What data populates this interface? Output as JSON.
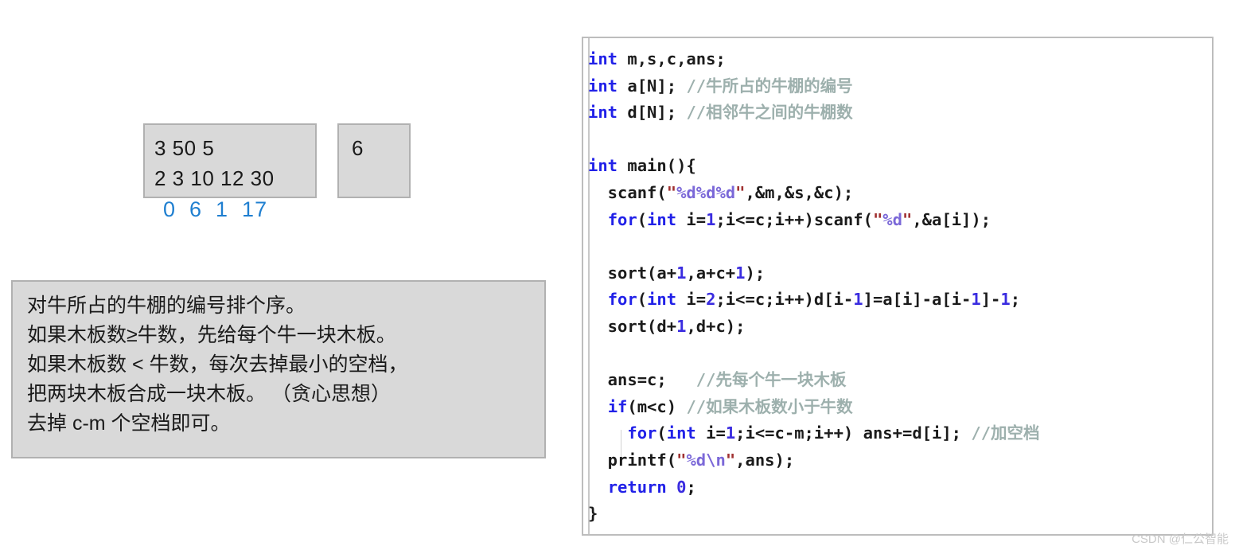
{
  "sample": {
    "input_box": {
      "lines": [
        "3 50 5",
        "2 3 10 12 30"
      ]
    },
    "output_box": {
      "lines": [
        "6"
      ]
    },
    "gap_numbers": "0  6  1  17"
  },
  "explanation": {
    "lines": [
      "对牛所占的牛棚的编号排个序。",
      "如果木板数≥牛数，先给每个牛一块木板。",
      "如果木板数 < 牛数，每次去掉最小的空档，",
      "把两块木板合成一块木板。 （贪心思想）",
      "去掉 c-m 个空档即可。"
    ]
  },
  "code": {
    "language": "cpp",
    "lines": [
      {
        "id": "l1",
        "tokens": [
          {
            "t": "int",
            "c": "kw"
          },
          {
            "t": " m,s,c,ans;",
            "c": "id"
          }
        ]
      },
      {
        "id": "l2",
        "tokens": [
          {
            "t": "int",
            "c": "kw"
          },
          {
            "t": " a[N]; ",
            "c": "id"
          },
          {
            "t": "//牛所占的牛棚的编号",
            "c": "cmt"
          }
        ]
      },
      {
        "id": "l3",
        "tokens": [
          {
            "t": "int",
            "c": "kw"
          },
          {
            "t": " d[N]; ",
            "c": "id"
          },
          {
            "t": "//相邻牛之间的牛棚数",
            "c": "cmt"
          }
        ]
      },
      {
        "id": "l4",
        "tokens": []
      },
      {
        "id": "l5",
        "tokens": [
          {
            "t": "int",
            "c": "kw"
          },
          {
            "t": " main(){",
            "c": "id"
          }
        ]
      },
      {
        "id": "l6",
        "tokens": [
          {
            "t": "  scanf(",
            "c": "id"
          },
          {
            "t": "\"",
            "c": "quo"
          },
          {
            "t": "%d%d%d",
            "c": "str"
          },
          {
            "t": "\"",
            "c": "quo"
          },
          {
            "t": ",&m,&s,&c);",
            "c": "id"
          }
        ]
      },
      {
        "id": "l7",
        "tokens": [
          {
            "t": "  ",
            "c": "id"
          },
          {
            "t": "for",
            "c": "kw"
          },
          {
            "t": "(",
            "c": "id"
          },
          {
            "t": "int",
            "c": "kw"
          },
          {
            "t": " i=",
            "c": "id"
          },
          {
            "t": "1",
            "c": "num"
          },
          {
            "t": ";i<=c;i++)scanf(",
            "c": "id"
          },
          {
            "t": "\"",
            "c": "quo"
          },
          {
            "t": "%d",
            "c": "str"
          },
          {
            "t": "\"",
            "c": "quo"
          },
          {
            "t": ",&a[i]);",
            "c": "id"
          }
        ]
      },
      {
        "id": "l8",
        "tokens": []
      },
      {
        "id": "l9",
        "tokens": [
          {
            "t": "  sort(a+",
            "c": "id"
          },
          {
            "t": "1",
            "c": "num"
          },
          {
            "t": ",a+c+",
            "c": "id"
          },
          {
            "t": "1",
            "c": "num"
          },
          {
            "t": ");",
            "c": "id"
          }
        ]
      },
      {
        "id": "l10",
        "tokens": [
          {
            "t": "  ",
            "c": "id"
          },
          {
            "t": "for",
            "c": "kw"
          },
          {
            "t": "(",
            "c": "id"
          },
          {
            "t": "int",
            "c": "kw"
          },
          {
            "t": " i=",
            "c": "id"
          },
          {
            "t": "2",
            "c": "num"
          },
          {
            "t": ";i<=c;i++)d[i-",
            "c": "id"
          },
          {
            "t": "1",
            "c": "num"
          },
          {
            "t": "]=a[i]-a[i-",
            "c": "id"
          },
          {
            "t": "1",
            "c": "num"
          },
          {
            "t": "]-",
            "c": "id"
          },
          {
            "t": "1",
            "c": "num"
          },
          {
            "t": ";",
            "c": "id"
          }
        ]
      },
      {
        "id": "l11",
        "tokens": [
          {
            "t": "  sort(d+",
            "c": "id"
          },
          {
            "t": "1",
            "c": "num"
          },
          {
            "t": ",d+c);",
            "c": "id"
          }
        ]
      },
      {
        "id": "l12",
        "tokens": []
      },
      {
        "id": "l13",
        "tokens": [
          {
            "t": "  ans=c;   ",
            "c": "id"
          },
          {
            "t": "//先每个牛一块木板",
            "c": "cmt"
          }
        ]
      },
      {
        "id": "l14",
        "tokens": [
          {
            "t": "  ",
            "c": "id"
          },
          {
            "t": "if",
            "c": "kw"
          },
          {
            "t": "(m<c) ",
            "c": "id"
          },
          {
            "t": "//如果木板数小于牛数",
            "c": "cmt"
          }
        ]
      },
      {
        "id": "l15",
        "tokens": [
          {
            "t": "    ",
            "c": "id"
          },
          {
            "t": "for",
            "c": "kw"
          },
          {
            "t": "(",
            "c": "id"
          },
          {
            "t": "int",
            "c": "kw"
          },
          {
            "t": " i=",
            "c": "id"
          },
          {
            "t": "1",
            "c": "num"
          },
          {
            "t": ";i<=c-m;i++) ans+=d[i]; ",
            "c": "id"
          },
          {
            "t": "//加空档",
            "c": "cmt"
          }
        ]
      },
      {
        "id": "l16",
        "tokens": [
          {
            "t": "  printf(",
            "c": "id"
          },
          {
            "t": "\"",
            "c": "quo"
          },
          {
            "t": "%d\\n",
            "c": "str"
          },
          {
            "t": "\"",
            "c": "quo"
          },
          {
            "t": ",ans);",
            "c": "id"
          }
        ]
      },
      {
        "id": "l17",
        "tokens": [
          {
            "t": "  ",
            "c": "id"
          },
          {
            "t": "return",
            "c": "kw"
          },
          {
            "t": " ",
            "c": "id"
          },
          {
            "t": "0",
            "c": "num"
          },
          {
            "t": ";",
            "c": "id"
          }
        ]
      },
      {
        "id": "l18",
        "tokens": [
          {
            "t": "}",
            "c": "id"
          }
        ]
      }
    ]
  },
  "watermark": {
    "text": "CSDN @仁公智能"
  },
  "colors": {
    "box_fill": "#d9d9d9",
    "box_border": "#b1b1b1",
    "gap_number": "#1f7fd0",
    "keyword": "#2121e8",
    "number": "#3a2ce0",
    "string": "#7b68d8",
    "quote": "#a03030",
    "comment": "#9db0ad",
    "code_border": "#bdbdbd"
  }
}
